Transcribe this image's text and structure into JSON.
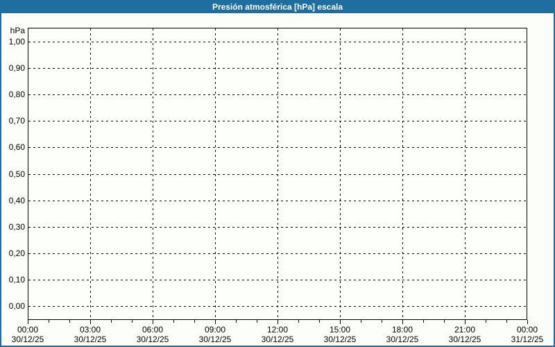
{
  "window": {
    "title": "Presión atmosférica [hPa] escala"
  },
  "chart_data": {
    "type": "line",
    "title": "Presión atmosférica [hPa] escala",
    "unit_label": "hPa",
    "grid": {
      "style": "dotted",
      "color": "#000000",
      "on": true
    },
    "y_axis": {
      "min": 0.0,
      "max": 1.0,
      "step": 0.1,
      "decimal_separator": ",",
      "tick_labels": [
        "1,00",
        "0,90",
        "0,80",
        "0,70",
        "0,60",
        "0,50",
        "0,40",
        "0,30",
        "0,20",
        "0,10",
        "0,00"
      ]
    },
    "x_axis": {
      "minor_tick_interval_hours": 1,
      "major_tick_interval_hours": 3,
      "major_ticks": [
        {
          "time": "00:00",
          "date": "30/12/25"
        },
        {
          "time": "03:00",
          "date": "30/12/25"
        },
        {
          "time": "06:00",
          "date": "30/12/25"
        },
        {
          "time": "09:00",
          "date": "30/12/25"
        },
        {
          "time": "12:00",
          "date": "30/12/25"
        },
        {
          "time": "15:00",
          "date": "30/12/25"
        },
        {
          "time": "18:00",
          "date": "30/12/25"
        },
        {
          "time": "21:00",
          "date": "30/12/25"
        },
        {
          "time": "00:00",
          "date": "31/12/25"
        }
      ]
    },
    "series": [],
    "colors": {
      "titlebar_bg": "#1E6EA0",
      "frame_border": "#1E6EA0",
      "page_bg": "#FCFFF9",
      "plot_border": "#000000",
      "grid": "#000000",
      "text": "#000000",
      "title_text": "#FFFFFF"
    }
  }
}
